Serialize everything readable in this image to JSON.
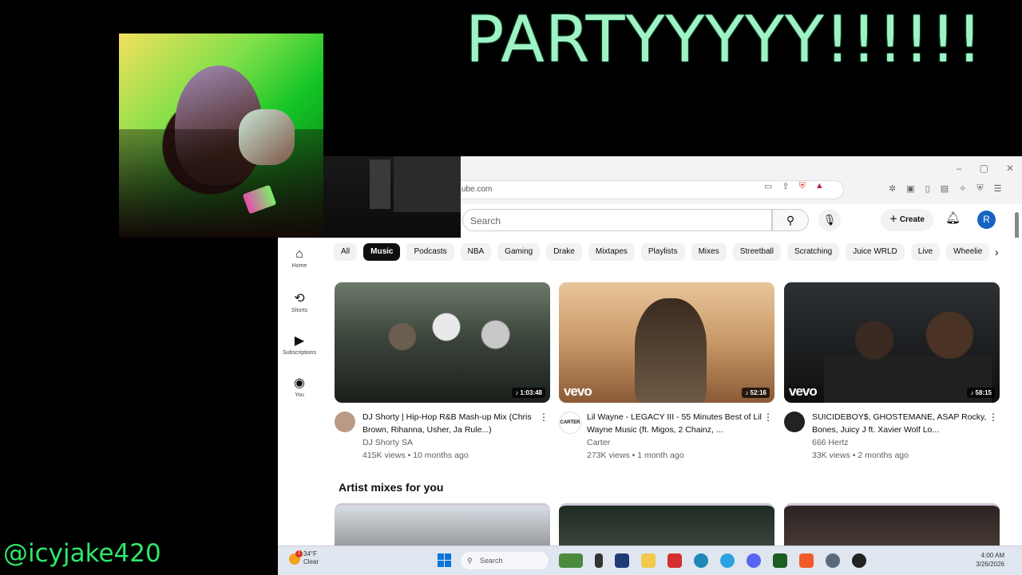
{
  "overlay": {
    "title": "PARTYYYYY!!!!!!",
    "handle": "@icyjake420"
  },
  "browser": {
    "url": "ube.com",
    "window_controls": [
      "–",
      "▢",
      "✕"
    ]
  },
  "youtube": {
    "search_placeholder": "Search",
    "create_label": "Create",
    "avatar_letter": "R",
    "sidebar": [
      {
        "label": "Home",
        "icon": "home-icon"
      },
      {
        "label": "Shorts",
        "icon": "shorts-icon"
      },
      {
        "label": "Subscriptions",
        "icon": "subscriptions-icon"
      },
      {
        "label": "You",
        "icon": "you-icon"
      }
    ],
    "chips": [
      "All",
      "Music",
      "Podcasts",
      "NBA",
      "Gaming",
      "Drake",
      "Mixtapes",
      "Playlists",
      "Mixes",
      "Streetball",
      "Scratching",
      "Juice WRLD",
      "Live",
      "Wheelie"
    ],
    "active_chip": "Music",
    "videos": [
      {
        "title": "DJ Shorty | Hip-Hop R&B Mash-up Mix (Chris Brown, Rihanna, Usher, Ja Rule...)",
        "channel": "DJ Shorty SA",
        "stats": "415K views • 10 months ago",
        "duration": "♪ 1:03:48"
      },
      {
        "title": "Lil Wayne - LEGACY III - 55 Minutes Best of Lil Wayne Music (ft. Migos, 2 Chainz, ...",
        "channel": "Carter",
        "stats": "273K views • 1 month ago",
        "duration": "♪ 52:16",
        "badge": "vevo",
        "channel_badge": "CARTER"
      },
      {
        "title": "SUICIDEBOY$, GHOSTEMANE, ASAP Rocky, Bones, Juicy J ft. Xavier Wolf Lo...",
        "channel": "666 Hertz",
        "stats": "33K views • 2 months ago",
        "duration": "♪ 58:15",
        "badge": "vevo"
      }
    ],
    "section_title": "Artist mixes for you"
  },
  "taskbar": {
    "weather_temp": "34°F",
    "weather_cond": "Clear",
    "weather_badge": "1",
    "search_label": "Search",
    "time": "4:00 AM",
    "date": "3/26/2026"
  },
  "colors": {
    "overlay_title": "#9ff2c4",
    "handle": "#2ee86b",
    "accent": "#1565c0"
  }
}
